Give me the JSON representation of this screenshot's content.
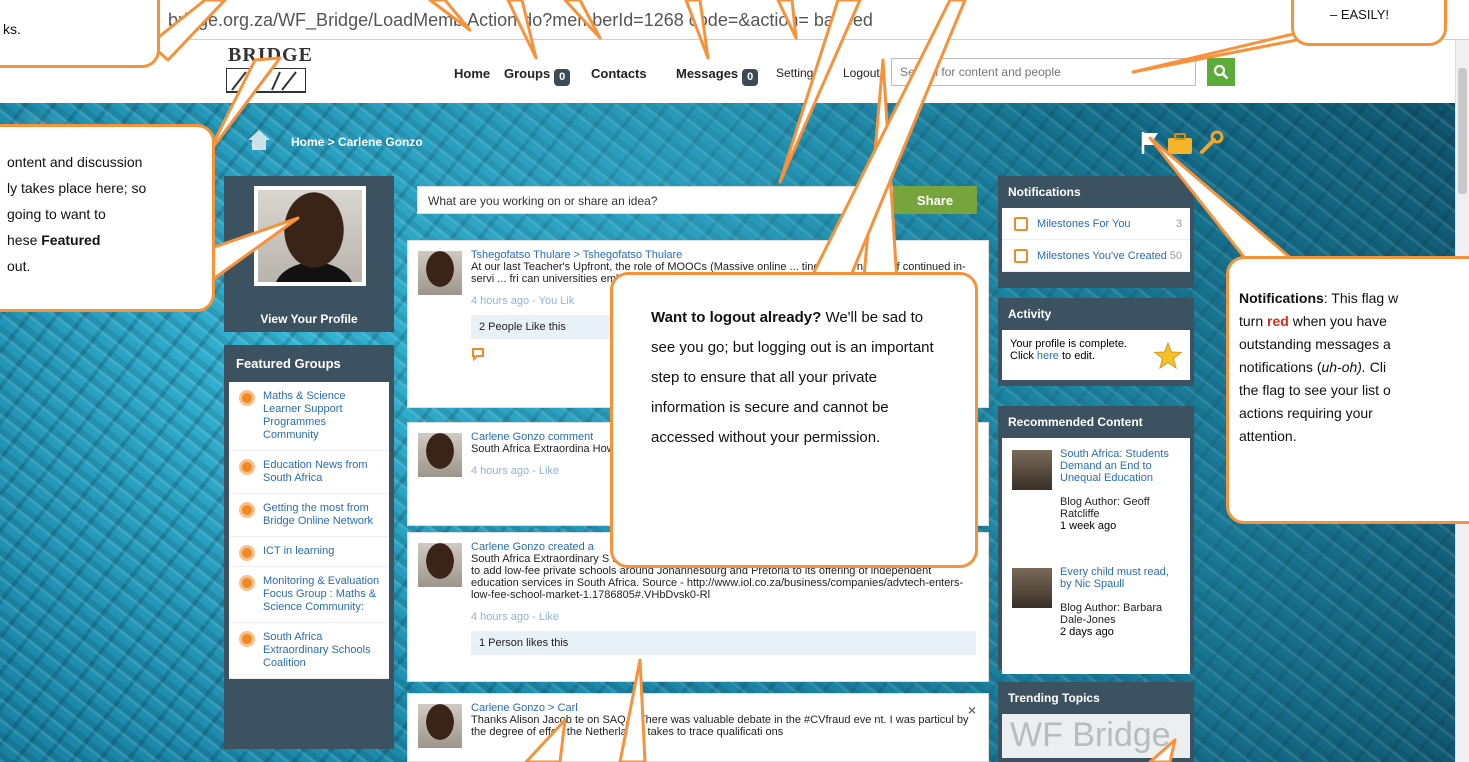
{
  "browser": {
    "url": "bridge.org.za/WF_Bridge/LoadMemb Action.do?memberId=1268 code=&action= balfeed"
  },
  "header": {
    "logo_text": "BRIDGE",
    "nav": [
      {
        "label": "Home"
      },
      {
        "label": "Groups",
        "count": "0"
      },
      {
        "label": "Contacts"
      },
      {
        "label": "Messages",
        "count": "0"
      },
      {
        "label": "Setting"
      },
      {
        "label": "Logout"
      }
    ],
    "search_placeholder": "Search for content and people"
  },
  "breadcrumb": "Home > Carlene Gonzo",
  "profile": {
    "view_label": "View Your Profile"
  },
  "featured": {
    "title": "Featured Groups",
    "items": [
      "Maths & Science Learner Support Programmes Community",
      "Education News from South Africa",
      "Getting the most from Bridge Online Network",
      "ICT in learning",
      "Monitoring & Evaluation Focus Group : Maths & Science Community:",
      "South Africa Extraordinary Schools Coalition"
    ]
  },
  "share": {
    "prompt": "What are you working on or share an idea?",
    "button": "Share"
  },
  "feed": [
    {
      "author": "Tshegofatso Thulare > Tshegofatso Thulare",
      "text": "At our last Teacher's Upfront, the role of MOOCs (Massive online ... tiner and e nabler of continued in-servi ... fri can universities embracin ... o.za/thetimes/2014/11/2",
      "meta": "4 hours ago - You Lik",
      "likes": "2 People Like this"
    },
    {
      "author": "Carlene Gonzo comment",
      "text": "South Africa Extraordina How does AdvTECH comp Tate ? This article sugge",
      "meta": "4 hours ago - Like"
    },
    {
      "author": "Carlene Gonzo created a",
      "text": "South Africa Extraordinary S Description: ADvTECH plans to buy Maravest Group for 450 million rand to add low-fee private schools around Johannesburg and Pretoria to its offering of independent education services in South Africa. Source - http://www.iol.co.za/business/companies/advtech-enters-low-fee-school-market-1.1786805#.VHbDvsk0-Rl",
      "meta": "4 hours ago - Like",
      "likes": "1 Person likes this"
    },
    {
      "author": "Carlene Gonzo > Carl",
      "text": "Thanks Alison Jacob  te on SAQA. There was valuable debate in the #CVfraud eve nt. I was particul  by the degree of effort the Netherlands takes to trace qualificati ons",
      "close": "×"
    }
  ],
  "notifications": {
    "title": "Notifications",
    "items": [
      {
        "label": "Milestones For You",
        "count": "3"
      },
      {
        "label": "Milestones You've Created",
        "count": "50"
      }
    ]
  },
  "activity": {
    "title": "Activity",
    "text": "Your profile is complete.",
    "click_pre": "Click ",
    "click_link": "here",
    "click_post": " to edit."
  },
  "recommended": {
    "title": "Recommended Content",
    "items": [
      {
        "title": "South Africa: Students Demand an End to Unequal Education",
        "author": "Blog Author: Geoff Ratcliffe",
        "time": "1 week ago"
      },
      {
        "title": "Every child must read, by Nic Spaull",
        "author": "Blog Author: Barbara Dale-Jones",
        "time": "2 days ago"
      }
    ]
  },
  "trending": {
    "title": "Trending Topics",
    "cloud": "WF Bridge"
  },
  "callouts": {
    "top_left_text": "ks.",
    "top_right_text": "– EASILY!",
    "featured": {
      "line1": "ontent and discussion",
      "line2": "ly takes place here; so",
      "line3": "going to want to",
      "line4_pre": "hese ",
      "line4_bold": "Featured",
      "line5": " out."
    },
    "logout": {
      "bold": "Want to logout already?",
      "rest": " We'll be sad to see you go; but logging out is an important step to ensure that all your private information is secure and cannot be accessed without your permission."
    },
    "notifications": {
      "bold1": "Notifications",
      "t1": ": This flag w",
      "t2": "turn ",
      "red": "red",
      "t3": " when you have",
      "t4": "outstanding messages a",
      "t5": "notifications (",
      "italic": "uh-oh).",
      "t6": " Cli",
      "t7": "the flag to see your list o",
      "t8": "actions requiring your",
      "t9": "attention."
    }
  },
  "colors": {
    "callout_border": "#f7923a",
    "panel": "#3d5260",
    "share_green": "#78a43e",
    "search_green": "#5cac3a",
    "link": "#2a6db0"
  }
}
